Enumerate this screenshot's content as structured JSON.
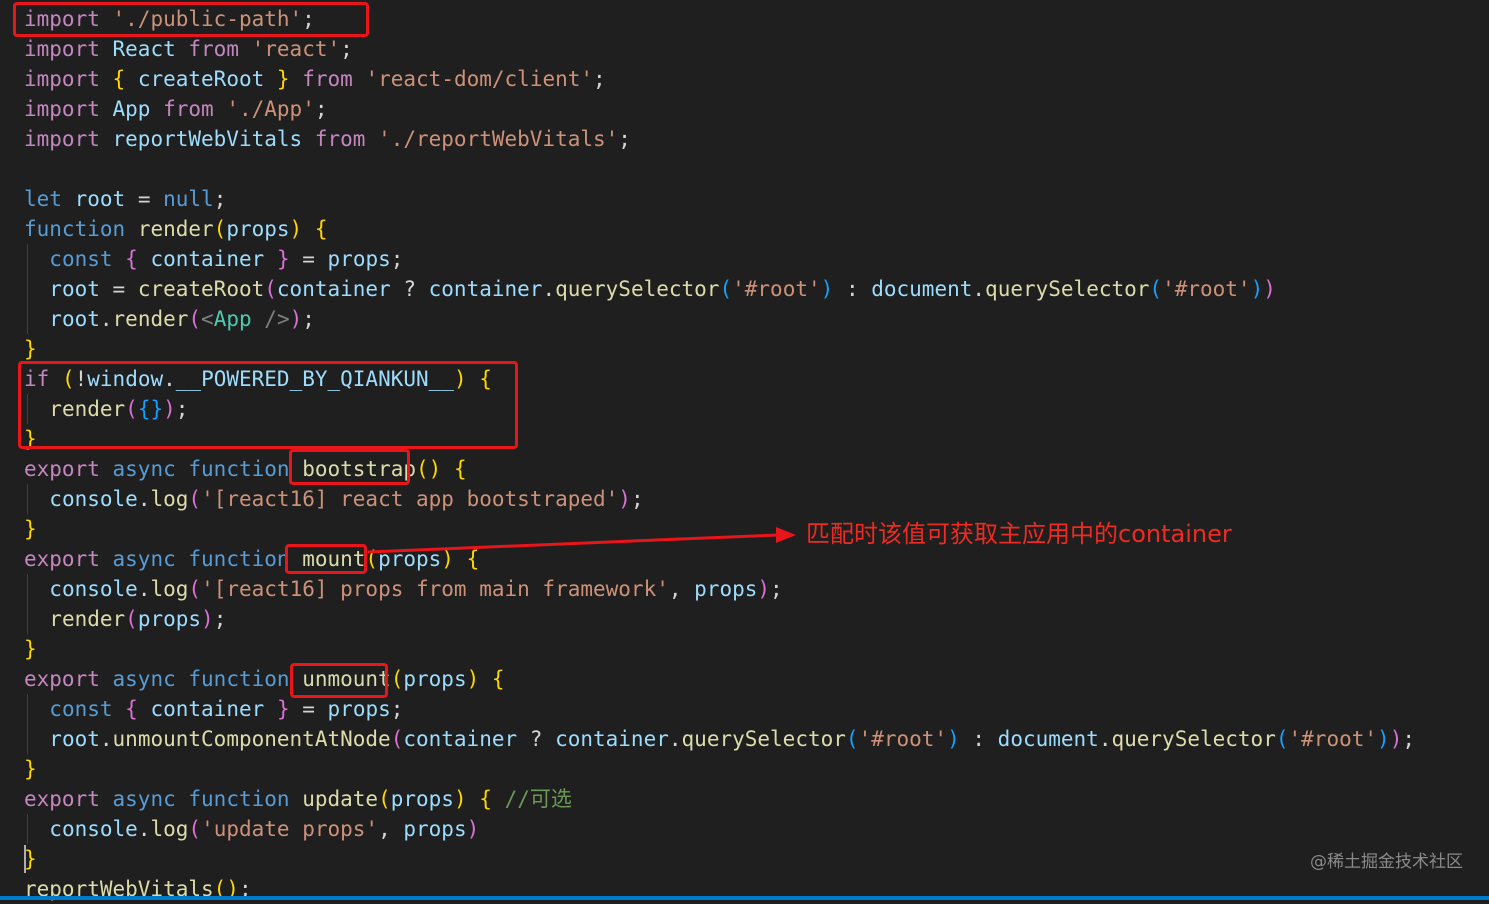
{
  "colors": {
    "background": "#1f1f1f",
    "keyword": "#569cd6",
    "control": "#c586c0",
    "function": "#dcdcaa",
    "variable": "#9cdcfe",
    "string": "#ce9178",
    "text": "#d4d4d4",
    "comment": "#6a9955",
    "bracket_gold": "#ffd700",
    "bracket_purple": "#da70d6",
    "bracket_blue": "#179fff",
    "jsx_tag": "#4ec9b0",
    "jsx_punct": "#808080",
    "highlight": "#e8151b",
    "annotation": "#ef2a20"
  },
  "code_lines": [
    [
      [
        "k",
        "import"
      ],
      [
        "t",
        " "
      ],
      [
        "s",
        "'./public-path'"
      ],
      [
        "t",
        ";"
      ]
    ],
    [
      [
        "k",
        "import"
      ],
      [
        "t",
        " "
      ],
      [
        "v",
        "React"
      ],
      [
        "t",
        " "
      ],
      [
        "k",
        "from"
      ],
      [
        "t",
        " "
      ],
      [
        "s",
        "'react'"
      ],
      [
        "t",
        ";"
      ]
    ],
    [
      [
        "k",
        "import"
      ],
      [
        "t",
        " "
      ],
      [
        "bg",
        "{"
      ],
      [
        "t",
        " "
      ],
      [
        "v",
        "createRoot"
      ],
      [
        "t",
        " "
      ],
      [
        "bg",
        "}"
      ],
      [
        "t",
        " "
      ],
      [
        "k",
        "from"
      ],
      [
        "t",
        " "
      ],
      [
        "s",
        "'react-dom/client'"
      ],
      [
        "t",
        ";"
      ]
    ],
    [
      [
        "k",
        "import"
      ],
      [
        "t",
        " "
      ],
      [
        "v",
        "App"
      ],
      [
        "t",
        " "
      ],
      [
        "k",
        "from"
      ],
      [
        "t",
        " "
      ],
      [
        "s",
        "'./App'"
      ],
      [
        "t",
        ";"
      ]
    ],
    [
      [
        "k",
        "import"
      ],
      [
        "t",
        " "
      ],
      [
        "v",
        "reportWebVitals"
      ],
      [
        "t",
        " "
      ],
      [
        "k",
        "from"
      ],
      [
        "t",
        " "
      ],
      [
        "s",
        "'./reportWebVitals'"
      ],
      [
        "t",
        ";"
      ]
    ],
    [],
    [
      [
        "d",
        "let"
      ],
      [
        "t",
        " "
      ],
      [
        "v",
        "root"
      ],
      [
        "t",
        " = "
      ],
      [
        "d",
        "null"
      ],
      [
        "t",
        ";"
      ]
    ],
    [
      [
        "d",
        "function"
      ],
      [
        "t",
        " "
      ],
      [
        "f",
        "render"
      ],
      [
        "bg",
        "("
      ],
      [
        "v",
        "props"
      ],
      [
        "bg",
        ")"
      ],
      [
        "t",
        " "
      ],
      [
        "bg",
        "{"
      ]
    ],
    [
      [
        "t",
        "  "
      ],
      [
        "d",
        "const"
      ],
      [
        "t",
        " "
      ],
      [
        "bp",
        "{"
      ],
      [
        "t",
        " "
      ],
      [
        "c",
        "container"
      ],
      [
        "t",
        " "
      ],
      [
        "bp",
        "}"
      ],
      [
        "t",
        " = "
      ],
      [
        "v",
        "props"
      ],
      [
        "t",
        ";"
      ]
    ],
    [
      [
        "t",
        "  "
      ],
      [
        "v",
        "root"
      ],
      [
        "t",
        " = "
      ],
      [
        "f",
        "createRoot"
      ],
      [
        "bp",
        "("
      ],
      [
        "v",
        "container"
      ],
      [
        "t",
        " ? "
      ],
      [
        "v",
        "container"
      ],
      [
        "t",
        "."
      ],
      [
        "f",
        "querySelector"
      ],
      [
        "bb",
        "("
      ],
      [
        "s",
        "'#root'"
      ],
      [
        "bb",
        ")"
      ],
      [
        "t",
        " : "
      ],
      [
        "v",
        "document"
      ],
      [
        "t",
        "."
      ],
      [
        "f",
        "querySelector"
      ],
      [
        "bb",
        "("
      ],
      [
        "s",
        "'#root'"
      ],
      [
        "bb",
        ")"
      ],
      [
        "bp",
        ")"
      ]
    ],
    [
      [
        "t",
        "  "
      ],
      [
        "v",
        "root"
      ],
      [
        "t",
        "."
      ],
      [
        "f",
        "render"
      ],
      [
        "bp",
        "("
      ],
      [
        "g",
        "<"
      ],
      [
        "j",
        "App"
      ],
      [
        "t",
        " "
      ],
      [
        "g",
        "/>"
      ],
      [
        "bp",
        ")"
      ],
      [
        "t",
        ";"
      ]
    ],
    [
      [
        "bg",
        "}"
      ]
    ],
    [
      [
        "k",
        "if"
      ],
      [
        "t",
        " "
      ],
      [
        "bg",
        "("
      ],
      [
        "t",
        "!"
      ],
      [
        "v",
        "window"
      ],
      [
        "t",
        "."
      ],
      [
        "v",
        "__POWERED_BY_QIANKUN__"
      ],
      [
        "bg",
        ")"
      ],
      [
        "t",
        " "
      ],
      [
        "bg",
        "{"
      ]
    ],
    [
      [
        "t",
        "  "
      ],
      [
        "f",
        "render"
      ],
      [
        "bp",
        "("
      ],
      [
        "bb",
        "{}"
      ],
      [
        "bp",
        ")"
      ],
      [
        "t",
        ";"
      ]
    ],
    [
      [
        "bg",
        "}"
      ]
    ],
    [
      [
        "k",
        "export"
      ],
      [
        "t",
        " "
      ],
      [
        "d",
        "async"
      ],
      [
        "t",
        " "
      ],
      [
        "d",
        "function"
      ],
      [
        "t",
        " "
      ],
      [
        "f",
        "bootstrap"
      ],
      [
        "bg",
        "()"
      ],
      [
        "t",
        " "
      ],
      [
        "bg",
        "{"
      ]
    ],
    [
      [
        "t",
        "  "
      ],
      [
        "v",
        "console"
      ],
      [
        "t",
        "."
      ],
      [
        "f",
        "log"
      ],
      [
        "bp",
        "("
      ],
      [
        "s",
        "'[react16] react app bootstraped'"
      ],
      [
        "bp",
        ")"
      ],
      [
        "t",
        ";"
      ]
    ],
    [
      [
        "bg",
        "}"
      ]
    ],
    [
      [
        "k",
        "export"
      ],
      [
        "t",
        " "
      ],
      [
        "d",
        "async"
      ],
      [
        "t",
        " "
      ],
      [
        "d",
        "function"
      ],
      [
        "t",
        " "
      ],
      [
        "f",
        "mount"
      ],
      [
        "bg",
        "("
      ],
      [
        "v",
        "props"
      ],
      [
        "bg",
        ")"
      ],
      [
        "t",
        " "
      ],
      [
        "bg",
        "{"
      ]
    ],
    [
      [
        "t",
        "  "
      ],
      [
        "v",
        "console"
      ],
      [
        "t",
        "."
      ],
      [
        "f",
        "log"
      ],
      [
        "bp",
        "("
      ],
      [
        "s",
        "'[react16] props from main framework'"
      ],
      [
        "t",
        ", "
      ],
      [
        "v",
        "props"
      ],
      [
        "bp",
        ")"
      ],
      [
        "t",
        ";"
      ]
    ],
    [
      [
        "t",
        "  "
      ],
      [
        "f",
        "render"
      ],
      [
        "bp",
        "("
      ],
      [
        "v",
        "props"
      ],
      [
        "bp",
        ")"
      ],
      [
        "t",
        ";"
      ]
    ],
    [
      [
        "bg",
        "}"
      ]
    ],
    [
      [
        "k",
        "export"
      ],
      [
        "t",
        " "
      ],
      [
        "d",
        "async"
      ],
      [
        "t",
        " "
      ],
      [
        "d",
        "function"
      ],
      [
        "t",
        " "
      ],
      [
        "f",
        "unmount"
      ],
      [
        "bg",
        "("
      ],
      [
        "v",
        "props"
      ],
      [
        "bg",
        ")"
      ],
      [
        "t",
        " "
      ],
      [
        "bg",
        "{"
      ]
    ],
    [
      [
        "t",
        "  "
      ],
      [
        "d",
        "const"
      ],
      [
        "t",
        " "
      ],
      [
        "bp",
        "{"
      ],
      [
        "t",
        " "
      ],
      [
        "c",
        "container"
      ],
      [
        "t",
        " "
      ],
      [
        "bp",
        "}"
      ],
      [
        "t",
        " = "
      ],
      [
        "v",
        "props"
      ],
      [
        "t",
        ";"
      ]
    ],
    [
      [
        "t",
        "  "
      ],
      [
        "v",
        "root"
      ],
      [
        "t",
        "."
      ],
      [
        "f",
        "unmountComponentAtNode"
      ],
      [
        "bp",
        "("
      ],
      [
        "v",
        "container"
      ],
      [
        "t",
        " ? "
      ],
      [
        "v",
        "container"
      ],
      [
        "t",
        "."
      ],
      [
        "f",
        "querySelector"
      ],
      [
        "bb",
        "("
      ],
      [
        "s",
        "'#root'"
      ],
      [
        "bb",
        ")"
      ],
      [
        "t",
        " : "
      ],
      [
        "v",
        "document"
      ],
      [
        "t",
        "."
      ],
      [
        "f",
        "querySelector"
      ],
      [
        "bb",
        "("
      ],
      [
        "s",
        "'#root'"
      ],
      [
        "bb",
        ")"
      ],
      [
        "bp",
        ")"
      ],
      [
        "t",
        ";"
      ]
    ],
    [
      [
        "bg",
        "}"
      ]
    ],
    [
      [
        "k",
        "export"
      ],
      [
        "t",
        " "
      ],
      [
        "d",
        "async"
      ],
      [
        "t",
        " "
      ],
      [
        "d",
        "function"
      ],
      [
        "t",
        " "
      ],
      [
        "f",
        "update"
      ],
      [
        "bg",
        "("
      ],
      [
        "v",
        "props"
      ],
      [
        "bg",
        ")"
      ],
      [
        "t",
        " "
      ],
      [
        "bg",
        "{"
      ],
      [
        "t",
        " "
      ],
      [
        "m",
        "//可选"
      ]
    ],
    [
      [
        "t",
        "  "
      ],
      [
        "v",
        "console"
      ],
      [
        "t",
        "."
      ],
      [
        "f",
        "log"
      ],
      [
        "bp",
        "("
      ],
      [
        "s",
        "'update props'"
      ],
      [
        "t",
        ", "
      ],
      [
        "v",
        "props"
      ],
      [
        "bp",
        ")"
      ]
    ],
    [
      [
        "bg",
        "}"
      ]
    ],
    [
      [
        "f",
        "reportWebVitals"
      ],
      [
        "bg",
        "()"
      ],
      [
        "t",
        ";"
      ]
    ]
  ],
  "annotation": {
    "text": "匹配时该值可获取主应用中的container"
  },
  "watermark": "@稀土掘金技术社区"
}
